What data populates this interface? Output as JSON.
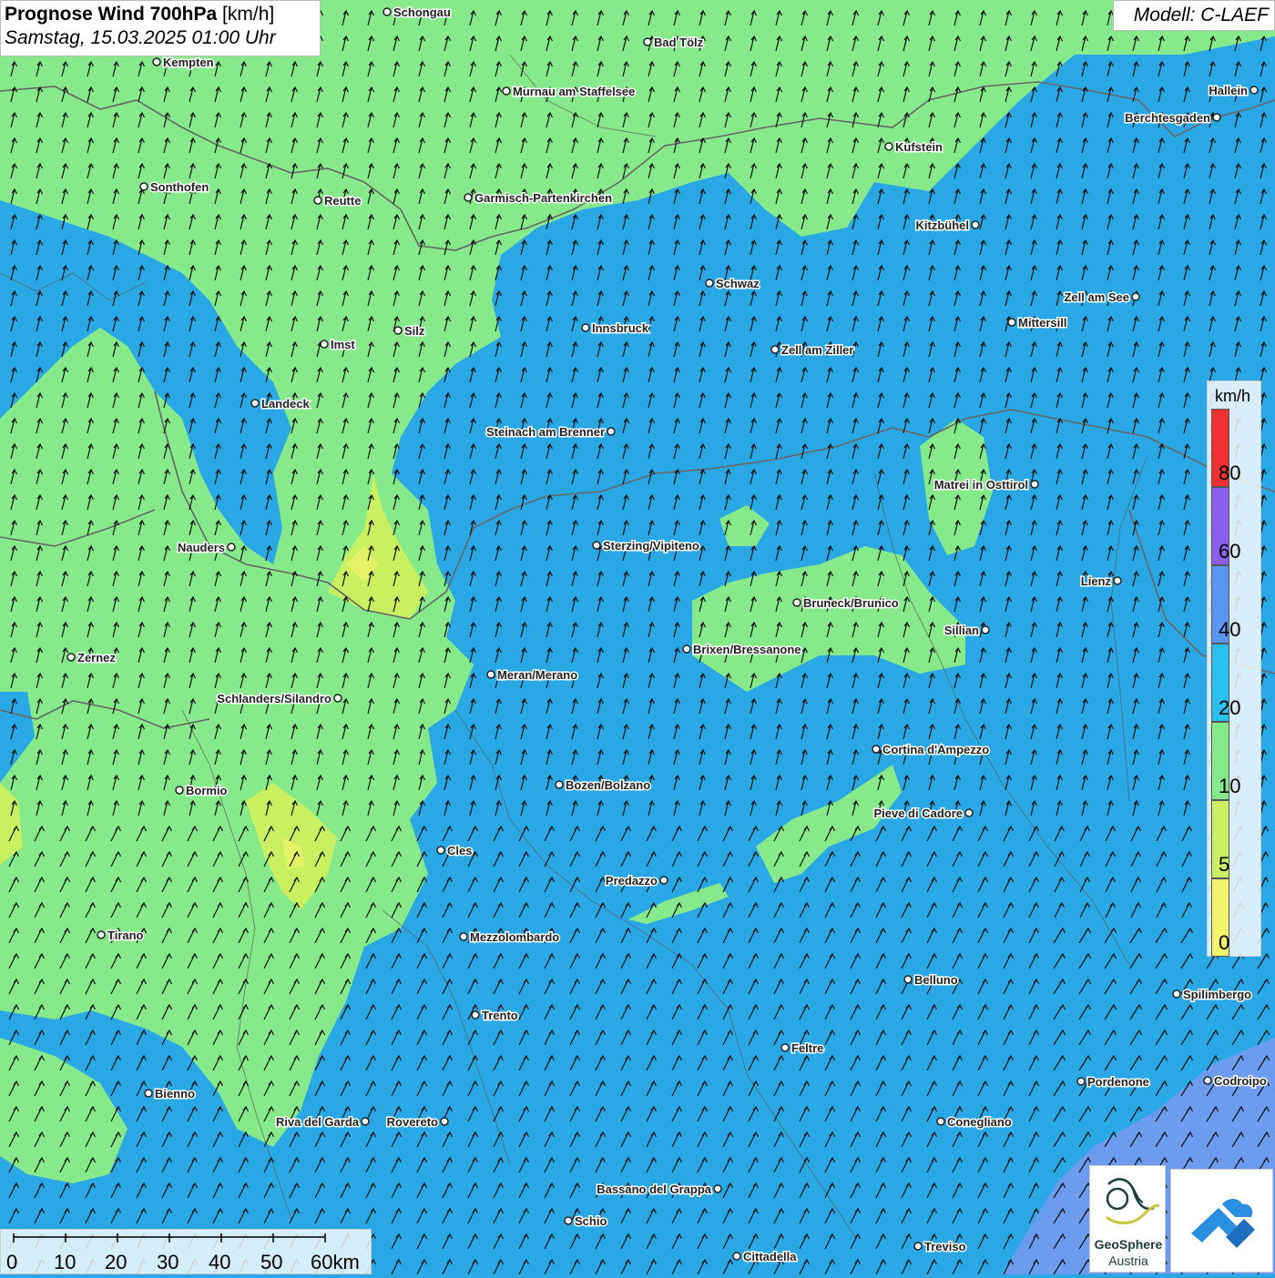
{
  "header": {
    "title_bold": "Prognose Wind 700hPa",
    "title_unit": "[km/h]",
    "datetime": "Samstag, 15.03.2025 01:00 Uhr",
    "model": "Modell: C-LAEF"
  },
  "legend": {
    "unit": "km/h",
    "classes": [
      {
        "label": "80",
        "color": "#f03030"
      },
      {
        "label": "60",
        "color": "#8a5ff0"
      },
      {
        "label": "40",
        "color": "#5a96f0"
      },
      {
        "label": "20",
        "color": "#28c0ee"
      },
      {
        "label": "10",
        "color": "#86ea8a"
      },
      {
        "label": "5",
        "color": "#c8f060"
      },
      {
        "label": "0",
        "color": "#f4f46a"
      }
    ]
  },
  "scalebar": {
    "labels": [
      "0",
      "10",
      "20",
      "30",
      "40",
      "50",
      "60km"
    ]
  },
  "branding": {
    "org_name": "GeoSphere",
    "org_sub": "Austria"
  },
  "colors": {
    "wind_10_20": "#86ea8a",
    "wind_20_40": "#2aa8e6",
    "wind_40_60": "#6b9cf0",
    "wind_5_10": "#c8f060",
    "wind_0_5": "#f4f46a",
    "arrow": "#111111",
    "border": "#666666"
  },
  "cities": [
    {
      "name": "Schongau"
    },
    {
      "name": "Bad Tölz"
    },
    {
      "name": "Kempten"
    },
    {
      "name": "Murnau am Staffelsee"
    },
    {
      "name": "Hallein"
    },
    {
      "name": "Berchtesgaden"
    },
    {
      "name": "Kufstein"
    },
    {
      "name": "Sonthofen"
    },
    {
      "name": "Reutte"
    },
    {
      "name": "Garmisch-Partenkirchen"
    },
    {
      "name": "Kitzbühel"
    },
    {
      "name": "Schwaz"
    },
    {
      "name": "Zell am See"
    },
    {
      "name": "Mittersill"
    },
    {
      "name": "Silz"
    },
    {
      "name": "Innsbruck"
    },
    {
      "name": "Imst"
    },
    {
      "name": "Zell am Ziller"
    },
    {
      "name": "Landeck"
    },
    {
      "name": "Steinach am Brenner"
    },
    {
      "name": "Matrei in Osttirol"
    },
    {
      "name": "Nauders"
    },
    {
      "name": "Sterzing/Vipiteno"
    },
    {
      "name": "Lienz"
    },
    {
      "name": "Bruneck/Brunico"
    },
    {
      "name": "Sillian"
    },
    {
      "name": "Zernez"
    },
    {
      "name": "Brixen/Bressanone"
    },
    {
      "name": "Meran/Merano"
    },
    {
      "name": "Schlanders/Silandro"
    },
    {
      "name": "Cortina d'Ampezzo"
    },
    {
      "name": "Bozen/Bolzano"
    },
    {
      "name": "Bormio"
    },
    {
      "name": "Pieve di Cadore"
    },
    {
      "name": "Cles"
    },
    {
      "name": "Predazzo"
    },
    {
      "name": "Mezzolombardo"
    },
    {
      "name": "Tirano"
    },
    {
      "name": "Belluno"
    },
    {
      "name": "Spilimbergo"
    },
    {
      "name": "Trento"
    },
    {
      "name": "Feltre"
    },
    {
      "name": "Pordenone"
    },
    {
      "name": "Codroipo"
    },
    {
      "name": "Bienno"
    },
    {
      "name": "Riva del Garda"
    },
    {
      "name": "Rovereto"
    },
    {
      "name": "Conegliano"
    },
    {
      "name": "Bassano del Grappa"
    },
    {
      "name": "Schio"
    },
    {
      "name": "Treviso"
    },
    {
      "name": "Cittadella"
    }
  ]
}
